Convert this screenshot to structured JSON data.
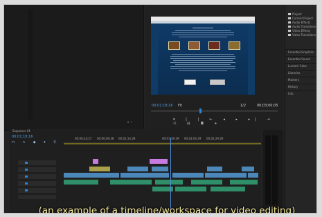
{
  "caption": "(an example of a timeline/workspace for video editing)",
  "program_monitor": {
    "timecode_left": "00;01;18;16",
    "fit_label": "Fit",
    "quality": "1/2",
    "timecode_right": "00;03;00;05"
  },
  "timeline": {
    "sequence_name": "Sequence 01",
    "timecode": "00;01;18;16",
    "ruler_labels": [
      "00;00;24;27",
      "00;00;49;28",
      "00;01;14;28",
      "00;01;39;29",
      "00;02;04;29",
      "00;02;29;29"
    ]
  },
  "project_panel": {
    "bins": [
      "Project",
      "Current Project",
      "Audio Effects",
      "Audio Transitions",
      "Video Effects",
      "Video Transitions"
    ],
    "panel_items": [
      "Essential Graphics",
      "Essential Sound",
      "Lumetri Color",
      "Libraries",
      "Markers",
      "History",
      "Info"
    ]
  },
  "colors": {
    "caption": "#f3e79a",
    "video_clip": "#4b88b9",
    "audio_clip": "#2f8f69",
    "accent_blue": "#2e83d6",
    "magenta_clip": "#c77be0"
  }
}
